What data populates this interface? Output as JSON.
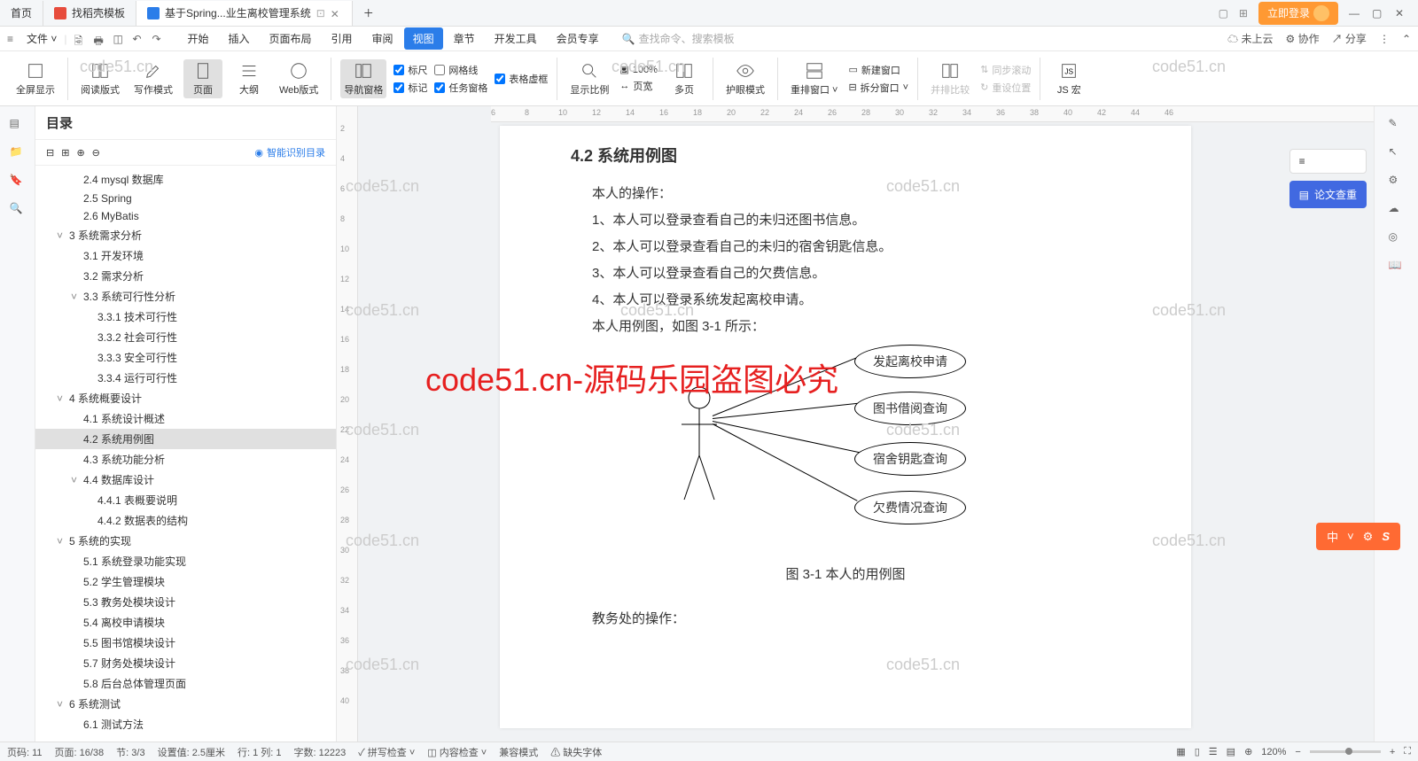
{
  "titlebar": {
    "tabs": [
      {
        "label": "首页",
        "icon": ""
      },
      {
        "label": "找稻壳模板",
        "icon": "red"
      },
      {
        "label": "基于Spring...业生离校管理系统",
        "icon": "blue",
        "active": true
      }
    ],
    "login": "立即登录",
    "layoutIcons": [
      "layout-icon",
      "grid-icon"
    ]
  },
  "menubar": {
    "fileLabel": "文件",
    "tabs": [
      "开始",
      "插入",
      "页面布局",
      "引用",
      "审阅",
      "视图",
      "章节",
      "开发工具",
      "会员专享"
    ],
    "activeTab": "视图",
    "searchPlaceholder": "查找命令、搜索模板",
    "rightItems": [
      "未上云",
      "协作",
      "分享"
    ]
  },
  "ribbon": {
    "fullscreen": "全屏显示",
    "readMode": "阅读版式",
    "writeMode": "写作模式",
    "pageMode": "页面",
    "outline": "大纲",
    "webMode": "Web版式",
    "navPane": "导航窗格",
    "checkboxes": {
      "ruler": "标尺",
      "gridlines": "网格线",
      "tableDash": "表格虚框",
      "markup": "标记",
      "taskPane": "任务窗格"
    },
    "showRatio": "显示比例",
    "zoom100": "100%",
    "pageWidth": "页宽",
    "multiPage": "多页",
    "eyeProtect": "护眼模式",
    "rearrange": "重排窗口",
    "newWindow": "新建窗口",
    "splitWindow": "拆分窗口",
    "compare": "并排比较",
    "syncScroll": "同步滚动",
    "resetPos": "重设位置",
    "jsMacro": "JS 宏"
  },
  "outline": {
    "title": "目录",
    "smartRecognize": "智能识别目录",
    "items": [
      {
        "label": "2.4 mysql 数据库",
        "level": 2
      },
      {
        "label": "2.5 Spring",
        "level": 2
      },
      {
        "label": "2.6 MyBatis",
        "level": 2
      },
      {
        "label": "3  系统需求分析",
        "level": 1,
        "exp": true
      },
      {
        "label": "3.1 开发环境",
        "level": 2
      },
      {
        "label": "3.2 需求分析",
        "level": 2
      },
      {
        "label": "3.3 系统可行性分析",
        "level": 2,
        "exp": true
      },
      {
        "label": "3.3.1 技术可行性",
        "level": 3
      },
      {
        "label": "3.3.2 社会可行性",
        "level": 3
      },
      {
        "label": "3.3.3 安全可行性",
        "level": 3
      },
      {
        "label": "3.3.4 运行可行性",
        "level": 3
      },
      {
        "label": "4  系统概要设计",
        "level": 1,
        "exp": true
      },
      {
        "label": "4.1 系统设计概述",
        "level": 2
      },
      {
        "label": "4.2 系统用例图",
        "level": 2,
        "active": true
      },
      {
        "label": "4.3 系统功能分析",
        "level": 2
      },
      {
        "label": "4.4 数据库设计",
        "level": 2,
        "exp": true
      },
      {
        "label": "4.4.1 表概要说明",
        "level": 3
      },
      {
        "label": "4.4.2 数据表的结构",
        "level": 3
      },
      {
        "label": "5  系统的实现",
        "level": 1,
        "exp": true
      },
      {
        "label": "5.1 系统登录功能实现",
        "level": 2
      },
      {
        "label": "5.2 学生管理模块",
        "level": 2
      },
      {
        "label": "5.3 教务处模块设计",
        "level": 2
      },
      {
        "label": "5.4 离校申请模块",
        "level": 2
      },
      {
        "label": "5.5 图书馆模块设计",
        "level": 2
      },
      {
        "label": "5.7 财务处模块设计",
        "level": 2
      },
      {
        "label": "5.8 后台总体管理页面",
        "level": 2
      },
      {
        "label": "6  系统测试",
        "level": 1,
        "exp": true
      },
      {
        "label": "6.1 测试方法",
        "level": 2
      }
    ]
  },
  "document": {
    "heading": "4.2  系统用例图",
    "intro": "本人的操作：",
    "lines": [
      "1、本人可以登录查看自己的未归还图书信息。",
      "2、本人可以登录查看自己的未归的宿舍钥匙信息。",
      "3、本人可以登录查看自己的欠费信息。",
      "4、本人可以登录系统发起离校申请。"
    ],
    "figRef": "本人用例图，如图 3-1 所示：",
    "usecases": [
      "发起离校申请",
      "图书借阅查询",
      "宿舍钥匙查询",
      "欠费情况查询"
    ],
    "caption": "图 3-1 本人的用例图",
    "next": "教务处的操作："
  },
  "rightPanel": {
    "menuBtn": "≡",
    "thesisCheck": "论文查重"
  },
  "ime": {
    "label": "中"
  },
  "statusbar": {
    "items": [
      "页码: 11",
      "页面: 16/38",
      "节: 3/3",
      "设置值: 2.5厘米",
      "行: 1  列: 1",
      "字数: 12223",
      "拼写检查",
      "内容检查",
      "兼容模式",
      "缺失字体"
    ],
    "zoom": "120%"
  },
  "watermark": "code51.cn",
  "bigWatermark": "code51.cn-源码乐园盗图必究"
}
